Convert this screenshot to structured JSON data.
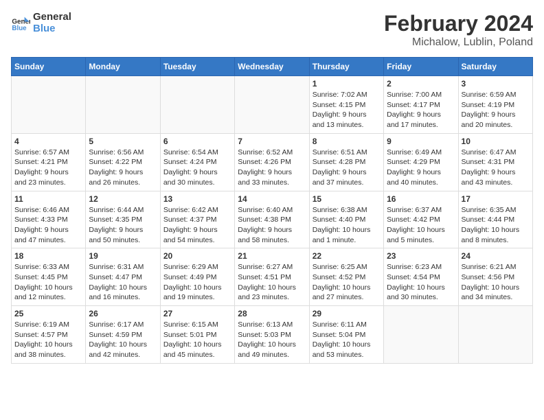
{
  "logo": {
    "text_general": "General",
    "text_blue": "Blue"
  },
  "title": "February 2024",
  "subtitle": "Michalow, Lublin, Poland",
  "weekdays": [
    "Sunday",
    "Monday",
    "Tuesday",
    "Wednesday",
    "Thursday",
    "Friday",
    "Saturday"
  ],
  "weeks": [
    [
      {
        "day": "",
        "info": ""
      },
      {
        "day": "",
        "info": ""
      },
      {
        "day": "",
        "info": ""
      },
      {
        "day": "",
        "info": ""
      },
      {
        "day": "1",
        "info": "Sunrise: 7:02 AM\nSunset: 4:15 PM\nDaylight: 9 hours\nand 13 minutes."
      },
      {
        "day": "2",
        "info": "Sunrise: 7:00 AM\nSunset: 4:17 PM\nDaylight: 9 hours\nand 17 minutes."
      },
      {
        "day": "3",
        "info": "Sunrise: 6:59 AM\nSunset: 4:19 PM\nDaylight: 9 hours\nand 20 minutes."
      }
    ],
    [
      {
        "day": "4",
        "info": "Sunrise: 6:57 AM\nSunset: 4:21 PM\nDaylight: 9 hours\nand 23 minutes."
      },
      {
        "day": "5",
        "info": "Sunrise: 6:56 AM\nSunset: 4:22 PM\nDaylight: 9 hours\nand 26 minutes."
      },
      {
        "day": "6",
        "info": "Sunrise: 6:54 AM\nSunset: 4:24 PM\nDaylight: 9 hours\nand 30 minutes."
      },
      {
        "day": "7",
        "info": "Sunrise: 6:52 AM\nSunset: 4:26 PM\nDaylight: 9 hours\nand 33 minutes."
      },
      {
        "day": "8",
        "info": "Sunrise: 6:51 AM\nSunset: 4:28 PM\nDaylight: 9 hours\nand 37 minutes."
      },
      {
        "day": "9",
        "info": "Sunrise: 6:49 AM\nSunset: 4:29 PM\nDaylight: 9 hours\nand 40 minutes."
      },
      {
        "day": "10",
        "info": "Sunrise: 6:47 AM\nSunset: 4:31 PM\nDaylight: 9 hours\nand 43 minutes."
      }
    ],
    [
      {
        "day": "11",
        "info": "Sunrise: 6:46 AM\nSunset: 4:33 PM\nDaylight: 9 hours\nand 47 minutes."
      },
      {
        "day": "12",
        "info": "Sunrise: 6:44 AM\nSunset: 4:35 PM\nDaylight: 9 hours\nand 50 minutes."
      },
      {
        "day": "13",
        "info": "Sunrise: 6:42 AM\nSunset: 4:37 PM\nDaylight: 9 hours\nand 54 minutes."
      },
      {
        "day": "14",
        "info": "Sunrise: 6:40 AM\nSunset: 4:38 PM\nDaylight: 9 hours\nand 58 minutes."
      },
      {
        "day": "15",
        "info": "Sunrise: 6:38 AM\nSunset: 4:40 PM\nDaylight: 10 hours\nand 1 minute."
      },
      {
        "day": "16",
        "info": "Sunrise: 6:37 AM\nSunset: 4:42 PM\nDaylight: 10 hours\nand 5 minutes."
      },
      {
        "day": "17",
        "info": "Sunrise: 6:35 AM\nSunset: 4:44 PM\nDaylight: 10 hours\nand 8 minutes."
      }
    ],
    [
      {
        "day": "18",
        "info": "Sunrise: 6:33 AM\nSunset: 4:45 PM\nDaylight: 10 hours\nand 12 minutes."
      },
      {
        "day": "19",
        "info": "Sunrise: 6:31 AM\nSunset: 4:47 PM\nDaylight: 10 hours\nand 16 minutes."
      },
      {
        "day": "20",
        "info": "Sunrise: 6:29 AM\nSunset: 4:49 PM\nDaylight: 10 hours\nand 19 minutes."
      },
      {
        "day": "21",
        "info": "Sunrise: 6:27 AM\nSunset: 4:51 PM\nDaylight: 10 hours\nand 23 minutes."
      },
      {
        "day": "22",
        "info": "Sunrise: 6:25 AM\nSunset: 4:52 PM\nDaylight: 10 hours\nand 27 minutes."
      },
      {
        "day": "23",
        "info": "Sunrise: 6:23 AM\nSunset: 4:54 PM\nDaylight: 10 hours\nand 30 minutes."
      },
      {
        "day": "24",
        "info": "Sunrise: 6:21 AM\nSunset: 4:56 PM\nDaylight: 10 hours\nand 34 minutes."
      }
    ],
    [
      {
        "day": "25",
        "info": "Sunrise: 6:19 AM\nSunset: 4:57 PM\nDaylight: 10 hours\nand 38 minutes."
      },
      {
        "day": "26",
        "info": "Sunrise: 6:17 AM\nSunset: 4:59 PM\nDaylight: 10 hours\nand 42 minutes."
      },
      {
        "day": "27",
        "info": "Sunrise: 6:15 AM\nSunset: 5:01 PM\nDaylight: 10 hours\nand 45 minutes."
      },
      {
        "day": "28",
        "info": "Sunrise: 6:13 AM\nSunset: 5:03 PM\nDaylight: 10 hours\nand 49 minutes."
      },
      {
        "day": "29",
        "info": "Sunrise: 6:11 AM\nSunset: 5:04 PM\nDaylight: 10 hours\nand 53 minutes."
      },
      {
        "day": "",
        "info": ""
      },
      {
        "day": "",
        "info": ""
      }
    ]
  ]
}
